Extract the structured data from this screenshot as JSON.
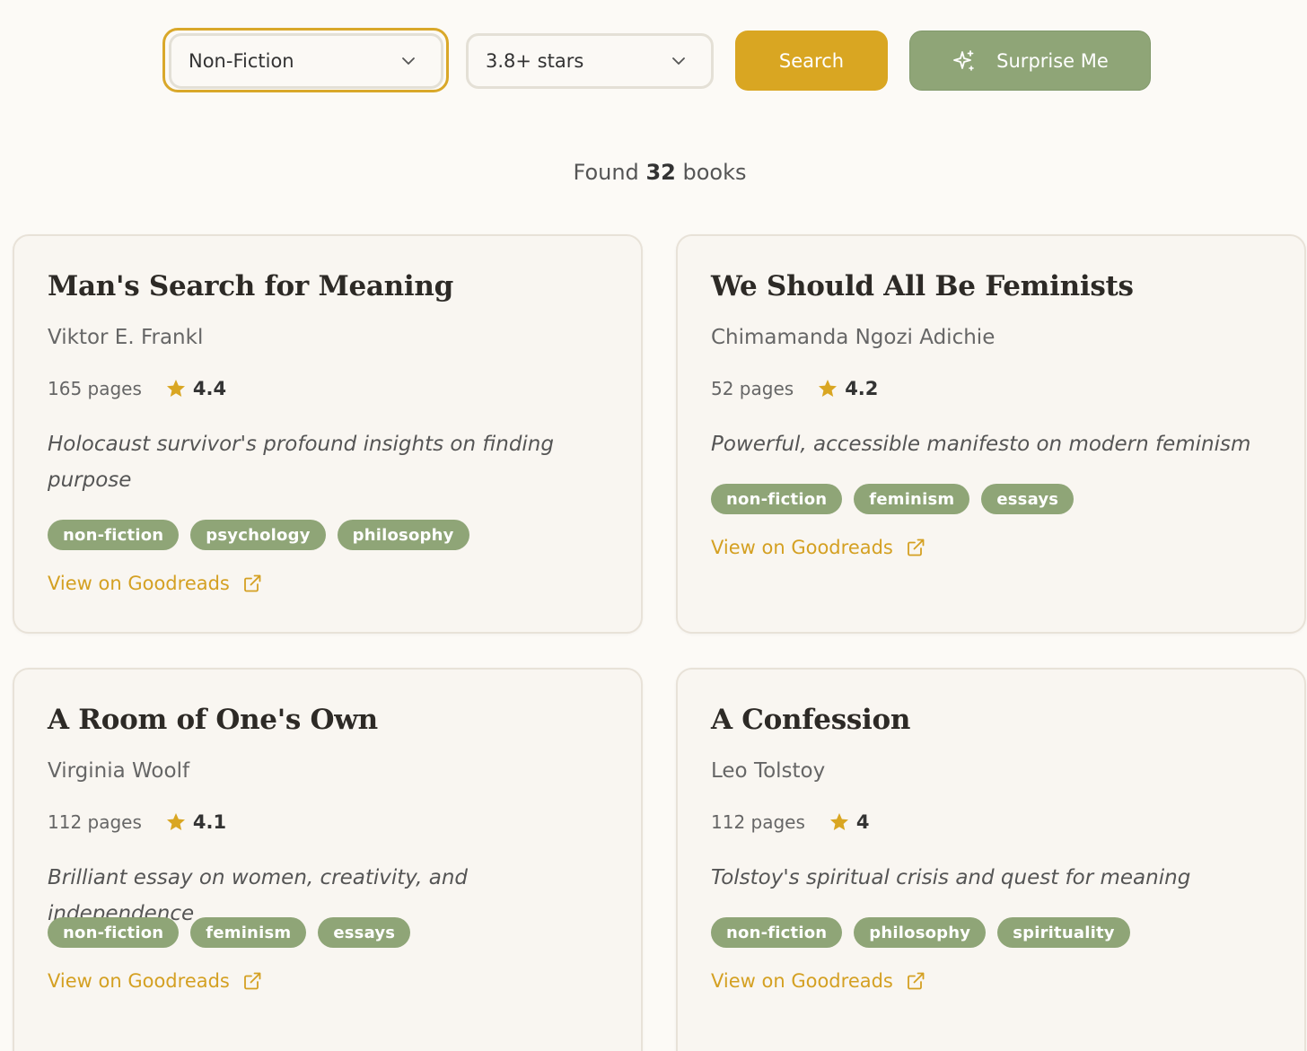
{
  "filters": {
    "genre": "Non-Fiction",
    "rating": "3.8+ stars",
    "search_label": "Search",
    "surprise_label": "Surprise Me"
  },
  "results": {
    "prefix": "Found",
    "count": "32",
    "suffix": "books"
  },
  "colors": {
    "accent": "#d9a622",
    "tag_green": "#8fa577",
    "background": "#fcfaf6"
  },
  "books": [
    {
      "title": "Man's Search for Meaning",
      "author": "Viktor E. Frankl",
      "pages": "165 pages",
      "rating": "4.4",
      "description": "Holocaust survivor's profound insights on finding purpose",
      "tags": [
        "non-fiction",
        "psychology",
        "philosophy"
      ],
      "link": "View on Goodreads"
    },
    {
      "title": "We Should All Be Feminists",
      "author": "Chimamanda Ngozi Adichie",
      "pages": "52 pages",
      "rating": "4.2",
      "description": "Powerful, accessible manifesto on modern feminism",
      "tags": [
        "non-fiction",
        "feminism",
        "essays"
      ],
      "link": "View on Goodreads"
    },
    {
      "title": "A Room of One's Own",
      "author": "Virginia Woolf",
      "pages": "112 pages",
      "rating": "4.1",
      "description": "Brilliant essay on women, creativity, and independence",
      "tags": [
        "non-fiction",
        "feminism",
        "essays"
      ],
      "link": "View on Goodreads"
    },
    {
      "title": "A Confession",
      "author": "Leo Tolstoy",
      "pages": "112 pages",
      "rating": "4",
      "description": "Tolstoy's spiritual crisis and quest for meaning",
      "tags": [
        "non-fiction",
        "philosophy",
        "spirituality"
      ],
      "link": "View on Goodreads"
    }
  ]
}
